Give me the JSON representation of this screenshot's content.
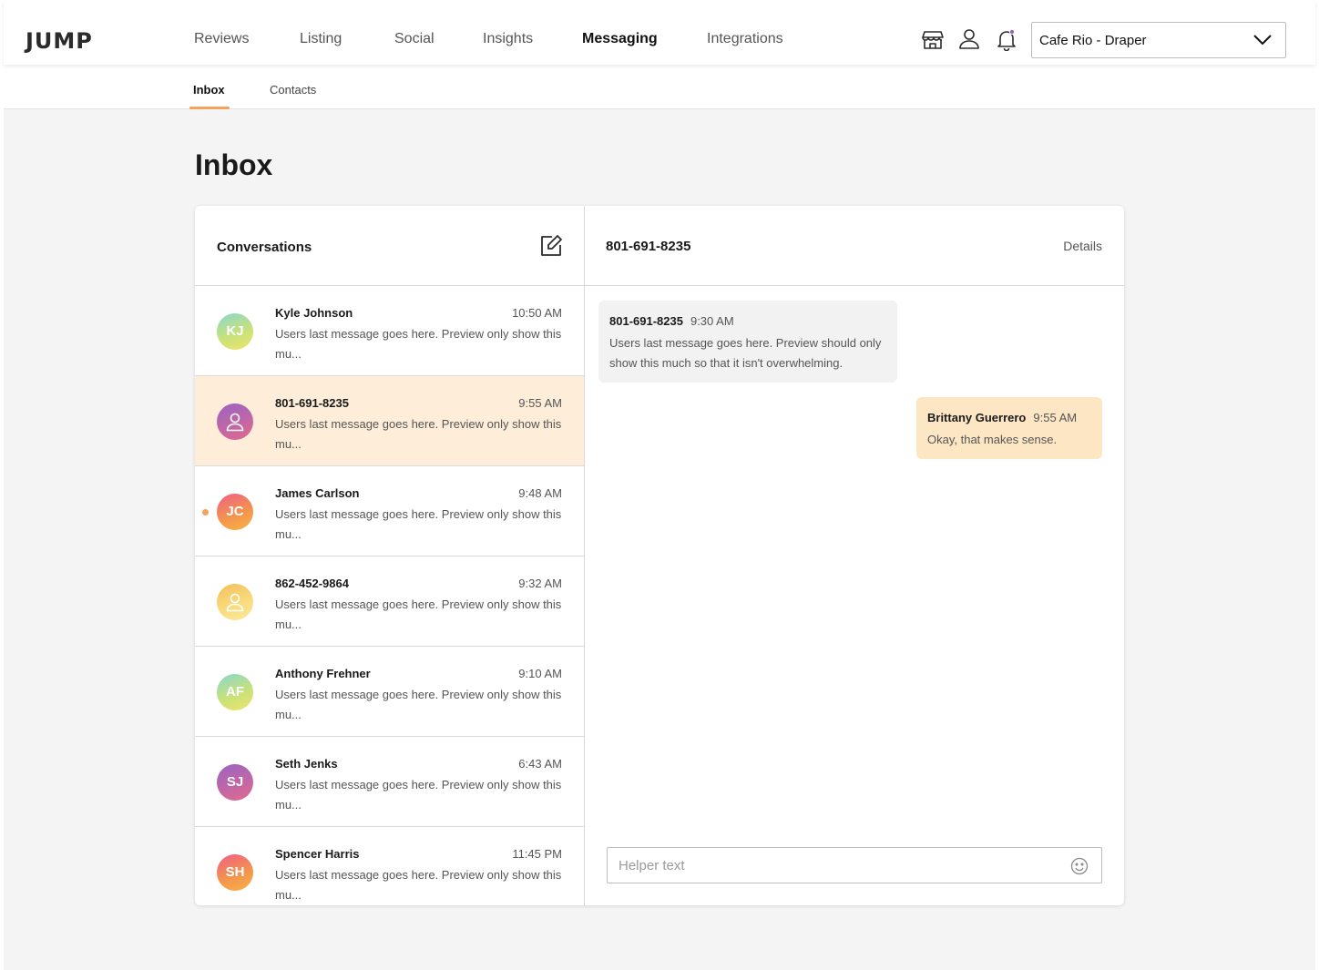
{
  "brand": {
    "logo_text": "JUMP",
    "accent": "#f5a35c",
    "selected_row_bg": "#feeed9"
  },
  "topnav": {
    "items": [
      {
        "label": "Reviews"
      },
      {
        "label": "Listing"
      },
      {
        "label": "Social"
      },
      {
        "label": "Insights"
      },
      {
        "label": "Messaging",
        "active": true
      },
      {
        "label": "Integrations"
      }
    ],
    "icons": [
      "store-icon",
      "user-icon",
      "bell-icon"
    ],
    "location_select": {
      "selected": "Cafe Rio - Draper"
    }
  },
  "subnav": {
    "tabs": [
      {
        "label": "Inbox",
        "active": true
      },
      {
        "label": "Contacts"
      }
    ]
  },
  "page": {
    "title": "Inbox"
  },
  "conversations": {
    "title": "Conversations",
    "items": [
      {
        "initials": "KJ",
        "name": "Kyle Johnson",
        "time": "10:50 AM",
        "preview": "Users last message goes here. Preview only show this mu...",
        "avatar_style": "green"
      },
      {
        "initials": "",
        "name": "801-691-8235",
        "time": "9:55 AM",
        "preview": "Users last message goes here. Preview only show this mu...",
        "avatar_style": "purple",
        "avatar_icon": "person-icon",
        "selected": true
      },
      {
        "initials": "JC",
        "name": "James Carlson",
        "time": "9:48 AM",
        "preview": "Users last message goes here. Preview only show this mu...",
        "avatar_style": "orange",
        "unread": true
      },
      {
        "initials": "",
        "name": "862-452-9864",
        "time": "9:32 AM",
        "preview": "Users last message goes here. Preview only show this mu...",
        "avatar_style": "yellow",
        "avatar_icon": "person-icon"
      },
      {
        "initials": "AF",
        "name": "Anthony Frehner",
        "time": "9:10 AM",
        "preview": "Users last message goes here. Preview only show this mu...",
        "avatar_style": "green"
      },
      {
        "initials": "SJ",
        "name": "Seth Jenks",
        "time": "6:43 AM",
        "preview": "Users last message goes here. Preview only show this mu...",
        "avatar_style": "purple"
      },
      {
        "initials": "SH",
        "name": "Spencer Harris",
        "time": "11:45 PM",
        "preview": "Users last message goes here. Preview only show this mu...",
        "avatar_style": "orange"
      }
    ]
  },
  "chat": {
    "title": "801-691-8235",
    "details_label": "Details",
    "messages": [
      {
        "direction": "incoming",
        "sender": "801-691-8235",
        "time": "9:30 AM",
        "text": "Users last message goes here. Preview should only show this much so that it isn't overwhelming."
      },
      {
        "direction": "outgoing",
        "sender": "Brittany Guerrero",
        "time": "9:55 AM",
        "text": "Okay, that makes sense."
      }
    ],
    "input": {
      "placeholder": "Helper text",
      "value": ""
    }
  }
}
